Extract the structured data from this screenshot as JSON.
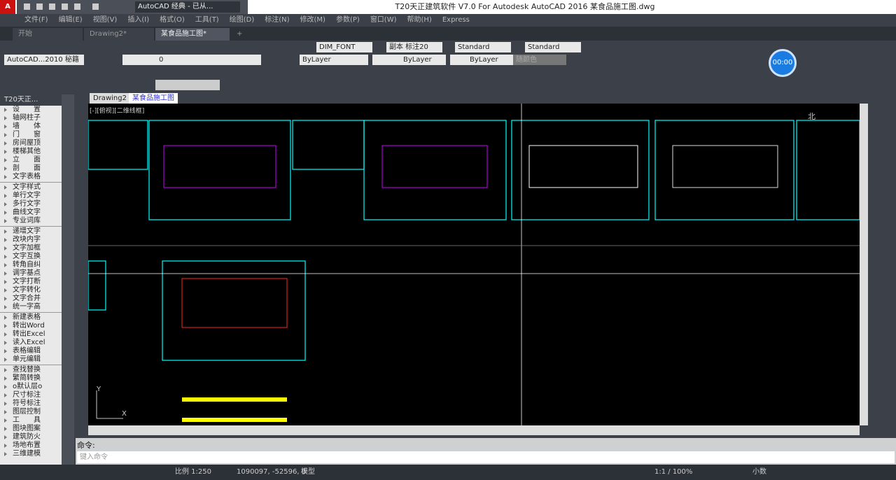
{
  "app": {
    "title": "T20天正建筑软件 V7.0 For Autodesk AutoCAD 2016    某食品施工图.dwg",
    "logo": "A",
    "workspace": "AutoCAD 经典 - 已从..."
  },
  "menu": [
    "文件(F)",
    "编辑(E)",
    "视图(V)",
    "插入(I)",
    "格式(O)",
    "工具(T)",
    "绘图(D)",
    "标注(N)",
    "修改(M)",
    "参数(P)",
    "窗口(W)",
    "帮助(H)",
    "Express"
  ],
  "doc_tabs": [
    "开始",
    "Drawing2*",
    "某食品施工图*"
  ],
  "doc_tab_add": "+",
  "toolbar": {
    "text_style": "DIM_FONT",
    "dim_style": "副本 标注20",
    "table_style": "Standard",
    "multileader_style": "Standard",
    "workspace_dd": "AutoCAD...2010 秘籍",
    "layer": "0",
    "color": "ByLayer",
    "linetype": "ByLayer",
    "lineweight": "ByLayer",
    "plotstyle": "随颜色"
  },
  "timer": "00:00",
  "palette": {
    "title": "T20天正...",
    "groups": [
      [
        "设　　置",
        "轴网柱子",
        "墙　　体",
        "门　　窗",
        "房间屋顶",
        "楼梯其他",
        "立　　面",
        "剖　　面",
        "文字表格"
      ],
      [
        "文字样式",
        "单行文字",
        "多行文字",
        "曲线文字",
        "专业词库"
      ],
      [
        "递增文字",
        "改块内字",
        "文字加框",
        "文字互换",
        "转角自纠",
        "调字基点",
        "文字打断",
        "文字转化",
        "文字合并",
        "统一字高"
      ],
      [
        "新建表格",
        "转出Word",
        "转出Excel",
        "读入Excel",
        "表格编辑",
        "单元编辑"
      ],
      [
        "查找替换",
        "繁简转换",
        "o默认层o",
        "尺寸标注",
        "符号标注",
        "图层控制",
        "工　　具",
        "图块图案",
        "建筑防火",
        "场地布置",
        "三维建模"
      ]
    ]
  },
  "viewport_tabs": [
    "Drawing2",
    "某食品施工图"
  ],
  "viewport_label": "[-][俯视][二维线框]",
  "compass": "北",
  "ucs": {
    "x": "X",
    "y": "Y"
  },
  "command": {
    "label": "命令:",
    "placeholder": "键入命令"
  },
  "status": {
    "scale": "比例 1:250",
    "coords": "1090097, -52596, 0",
    "model": "模型",
    "annoscale": "1:1 / 100%",
    "units": "小数"
  }
}
